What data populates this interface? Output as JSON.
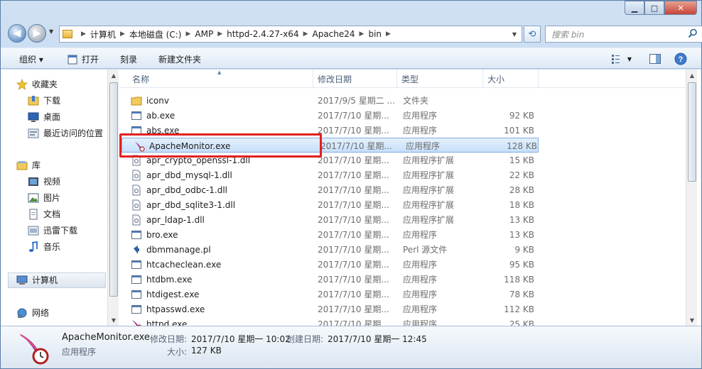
{
  "window": {
    "caption_buttons": {
      "minimize": "▁",
      "maximize": "□",
      "close": "✕"
    }
  },
  "address": {
    "crumbs": [
      "计算机",
      "本地磁盘 (C:)",
      "AMP",
      "httpd-2.4.27-x64",
      "Apache24",
      "bin"
    ],
    "search_placeholder": "搜索 bin"
  },
  "toolbar": {
    "organize": "组织 ▾",
    "open": "打开",
    "burn": "刻录",
    "new_folder": "新建文件夹"
  },
  "nav": {
    "favorites": "收藏夹",
    "downloads": "下载",
    "desktop": "桌面",
    "recent": "最近访问的位置",
    "libraries": "库",
    "videos": "视频",
    "pictures": "图片",
    "documents": "文档",
    "thunder": "迅雷下载",
    "music": "音乐",
    "computer": "计算机",
    "network": "网络"
  },
  "columns": {
    "name": "名称",
    "date": "修改日期",
    "type": "类型",
    "size": "大小"
  },
  "files": [
    {
      "name": "iconv",
      "date": "2017/9/5 星期二 ...",
      "type": "文件夹",
      "size": "",
      "icon": "folder-icon"
    },
    {
      "name": "ab.exe",
      "date": "2017/7/10 星期...",
      "type": "应用程序",
      "size": "92 KB",
      "icon": "exe-icon"
    },
    {
      "name": "abs.exe",
      "date": "2017/7/10 星期...",
      "type": "应用程序",
      "size": "101 KB",
      "icon": "exe-icon"
    },
    {
      "name": "ApacheMonitor.exe",
      "date": "2017/7/10 星期...",
      "type": "应用程序",
      "size": "128 KB",
      "icon": "apache-feather-icon"
    },
    {
      "name": "apr_crypto_openssl-1.dll",
      "date": "2017/7/10 星期...",
      "type": "应用程序扩展",
      "size": "15 KB",
      "icon": "dll-icon"
    },
    {
      "name": "apr_dbd_mysql-1.dll",
      "date": "2017/7/10 星期...",
      "type": "应用程序扩展",
      "size": "22 KB",
      "icon": "dll-icon"
    },
    {
      "name": "apr_dbd_odbc-1.dll",
      "date": "2017/7/10 星期...",
      "type": "应用程序扩展",
      "size": "28 KB",
      "icon": "dll-icon"
    },
    {
      "name": "apr_dbd_sqlite3-1.dll",
      "date": "2017/7/10 星期...",
      "type": "应用程序扩展",
      "size": "18 KB",
      "icon": "dll-icon"
    },
    {
      "name": "apr_ldap-1.dll",
      "date": "2017/7/10 星期...",
      "type": "应用程序扩展",
      "size": "13 KB",
      "icon": "dll-icon"
    },
    {
      "name": "bro.exe",
      "date": "2017/7/10 星期...",
      "type": "应用程序",
      "size": "13 KB",
      "icon": "exe-icon"
    },
    {
      "name": "dbmmanage.pl",
      "date": "2017/7/10 星期...",
      "type": "Perl 源文件",
      "size": "9 KB",
      "icon": "perl-icon"
    },
    {
      "name": "htcacheclean.exe",
      "date": "2017/7/10 星期...",
      "type": "应用程序",
      "size": "95 KB",
      "icon": "exe-icon"
    },
    {
      "name": "htdbm.exe",
      "date": "2017/7/10 星期...",
      "type": "应用程序",
      "size": "118 KB",
      "icon": "exe-icon"
    },
    {
      "name": "htdigest.exe",
      "date": "2017/7/10 星期...",
      "type": "应用程序",
      "size": "78 KB",
      "icon": "exe-icon"
    },
    {
      "name": "htpasswd.exe",
      "date": "2017/7/10 星期...",
      "type": "应用程序",
      "size": "112 KB",
      "icon": "exe-icon"
    },
    {
      "name": "httpd.exe",
      "date": "2017/7/10 星期...",
      "type": "应用程序",
      "size": "25 KB",
      "icon": "apache-feather-icon"
    }
  ],
  "details": {
    "name": "ApacheMonitor.exe",
    "type": "应用程序",
    "modified_label": "修改日期:",
    "modified_value": "2017/7/10 星期一 10:02",
    "created_label": "创建日期:",
    "created_value": "2017/7/10 星期一 12:45",
    "size_label": "大小:",
    "size_value": "127 KB"
  }
}
